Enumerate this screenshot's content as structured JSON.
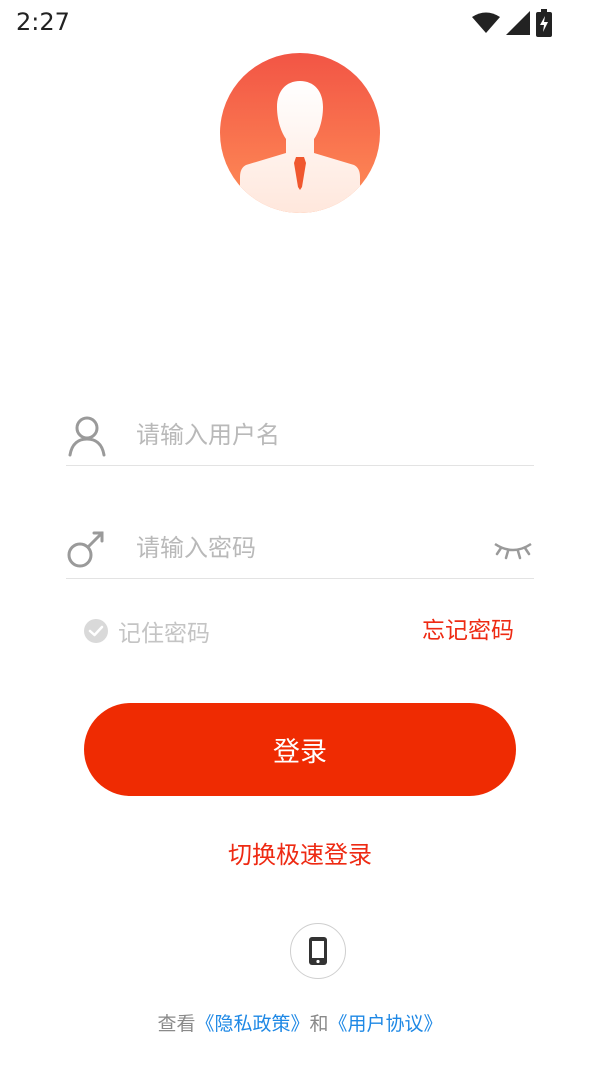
{
  "status_bar": {
    "time": "2:27",
    "icons": [
      "wifi-icon",
      "signal-icon",
      "battery-charging-icon"
    ]
  },
  "login_form": {
    "username_placeholder": "请输入用户名",
    "password_placeholder": "请输入密码",
    "remember_label": "记住密码",
    "forgot_label": "忘记密码",
    "login_button": "登录",
    "quick_login_link": "切换极速登录"
  },
  "footer": {
    "prefix": "查看",
    "privacy_link": "《隐私政策》",
    "conjunction": "和",
    "terms_link": "《用户协议》",
    "phone_icon": "phone-icon"
  },
  "colors": {
    "primary_red": "#ef2b02",
    "link_blue": "#1e88e5",
    "avatar_gradient_top": "#f25a4a",
    "avatar_gradient_bottom": "#ff8f5a"
  }
}
